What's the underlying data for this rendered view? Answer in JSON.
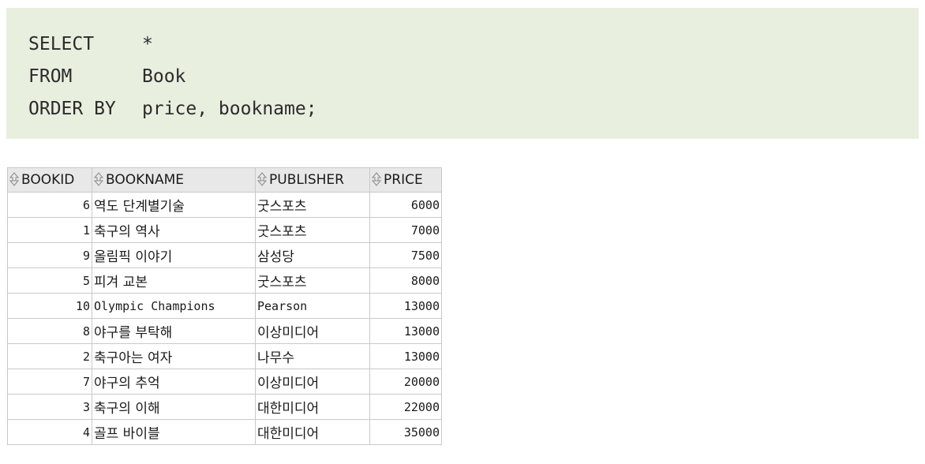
{
  "sql": {
    "lines": [
      {
        "keyword": "SELECT",
        "value": "*"
      },
      {
        "keyword": "FROM",
        "value": "Book"
      },
      {
        "keyword": "ORDER BY",
        "value": "price, bookname;"
      }
    ]
  },
  "grid": {
    "columns": [
      "BOOKID",
      "BOOKNAME",
      "PUBLISHER",
      "PRICE"
    ],
    "rows": [
      [
        "6",
        "역도 단계별기술",
        "굿스포츠",
        "6000"
      ],
      [
        "1",
        "축구의 역사",
        "굿스포츠",
        "7000"
      ],
      [
        "9",
        "올림픽 이야기",
        "삼성당",
        "7500"
      ],
      [
        "5",
        "피겨 교본",
        "굿스포츠",
        "8000"
      ],
      [
        "10",
        "Olympic Champions",
        "Pearson",
        "13000"
      ],
      [
        "8",
        "야구를 부탁해",
        "이상미디어",
        "13000"
      ],
      [
        "2",
        "축구아는 여자",
        "나무수",
        "13000"
      ],
      [
        "7",
        "야구의 추억",
        "이상미디어",
        "20000"
      ],
      [
        "3",
        "축구의 이해",
        "대한미디어",
        "22000"
      ],
      [
        "4",
        "골프 바이블",
        "대한미디어",
        "35000"
      ]
    ]
  },
  "colors": {
    "sql_background": "#e9efdf",
    "header_background": "#e8e8e8",
    "grid_border": "#c9c9c9"
  }
}
